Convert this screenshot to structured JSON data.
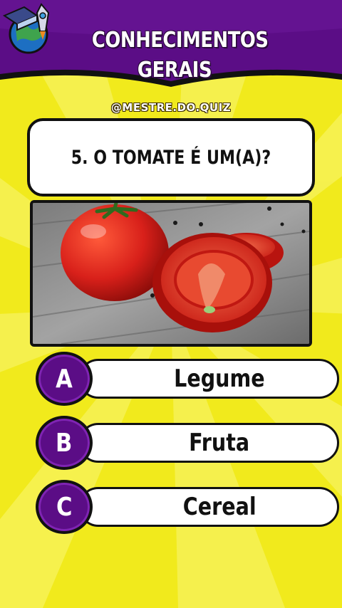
{
  "header": {
    "title_line1": "CONHECIMENTOS",
    "title_line2": "GERAIS",
    "handle": "@MESTRE.DO.QUIZ"
  },
  "question": {
    "text": "5. O TOMATE É UM(A)?"
  },
  "options": [
    {
      "letter": "A",
      "label": "Legume"
    },
    {
      "letter": "B",
      "label": "Fruta"
    },
    {
      "letter": "C",
      "label": "Cereal"
    }
  ],
  "colors": {
    "background": "#f1ea1c",
    "header_purple": "#5b0d86",
    "badge_purple": "#5b0d86",
    "tomato_red": "#d8201a"
  },
  "icons": {
    "logo": "globe-with-books-rocket-icon"
  }
}
